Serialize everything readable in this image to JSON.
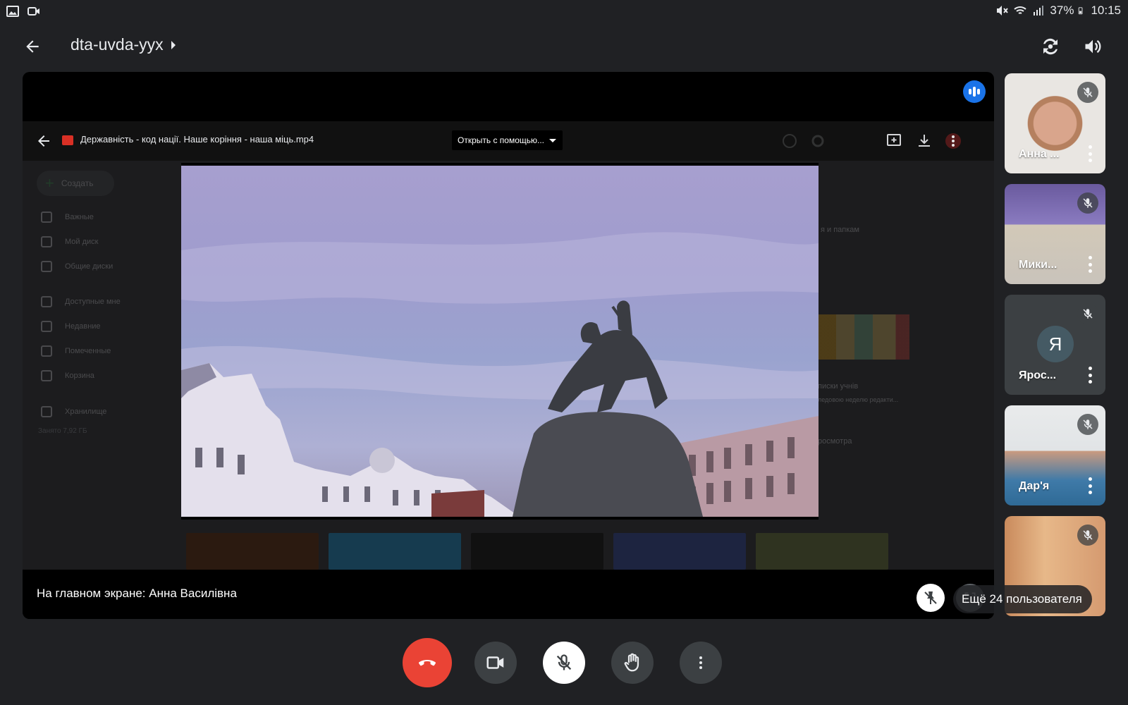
{
  "status_bar": {
    "battery": "37%",
    "time": "10:15",
    "left_icons": [
      "gallery-icon",
      "camera-notification-icon"
    ],
    "right_icons": [
      "mute-icon",
      "wifi-icon",
      "signal-icon",
      "battery-icon"
    ]
  },
  "header": {
    "meeting_code": "dta-uvda-yyx",
    "back_icon": "arrow-back-icon",
    "expand_icon": "caret-right-icon",
    "actions": [
      "switch-camera-icon",
      "speaker-icon"
    ]
  },
  "shared_screen": {
    "file_title": "Державність - код нації. Наше коріння - наша міць.mp4",
    "open_with_label": "Открыть с помощью...",
    "drive_sidebar": {
      "create_label": "Создать",
      "items": [
        "Важные",
        "Мой диск",
        "Общие диски",
        "Доступные мне",
        "Недавние",
        "Помеченные",
        "Корзина",
        "Хранилище"
      ],
      "quota": "Занято 7,92 ГБ"
    },
    "drive_right": {
      "hint": "я и папкам",
      "file_name": "писки учнів",
      "file_meta": "ледовою неделю редакти...",
      "sort_label": "росмотра"
    }
  },
  "main_caption": {
    "text": "На главном экране: Анна Василівна"
  },
  "participants": [
    {
      "name": "Анна ...",
      "muted": true,
      "kind": "video"
    },
    {
      "name": "Мики...",
      "muted": true,
      "kind": "video"
    },
    {
      "name": "Ярос...",
      "muted": true,
      "kind": "avatar",
      "initial": "Я"
    },
    {
      "name": "Дар'я",
      "muted": true,
      "kind": "video"
    },
    {
      "name": "",
      "muted": true,
      "kind": "video"
    }
  ],
  "more_users_label": "Ещё 24 пользователя",
  "controls": {
    "end_call": "end-call-icon",
    "camera": "camera-icon",
    "mic": "mic-off-icon",
    "raise_hand": "raise-hand-icon",
    "more": "more-vert-icon"
  },
  "colors": {
    "background": "#202124",
    "end_call": "#ea4335",
    "speaking": "#1a73e8",
    "control": "#3c4043"
  }
}
